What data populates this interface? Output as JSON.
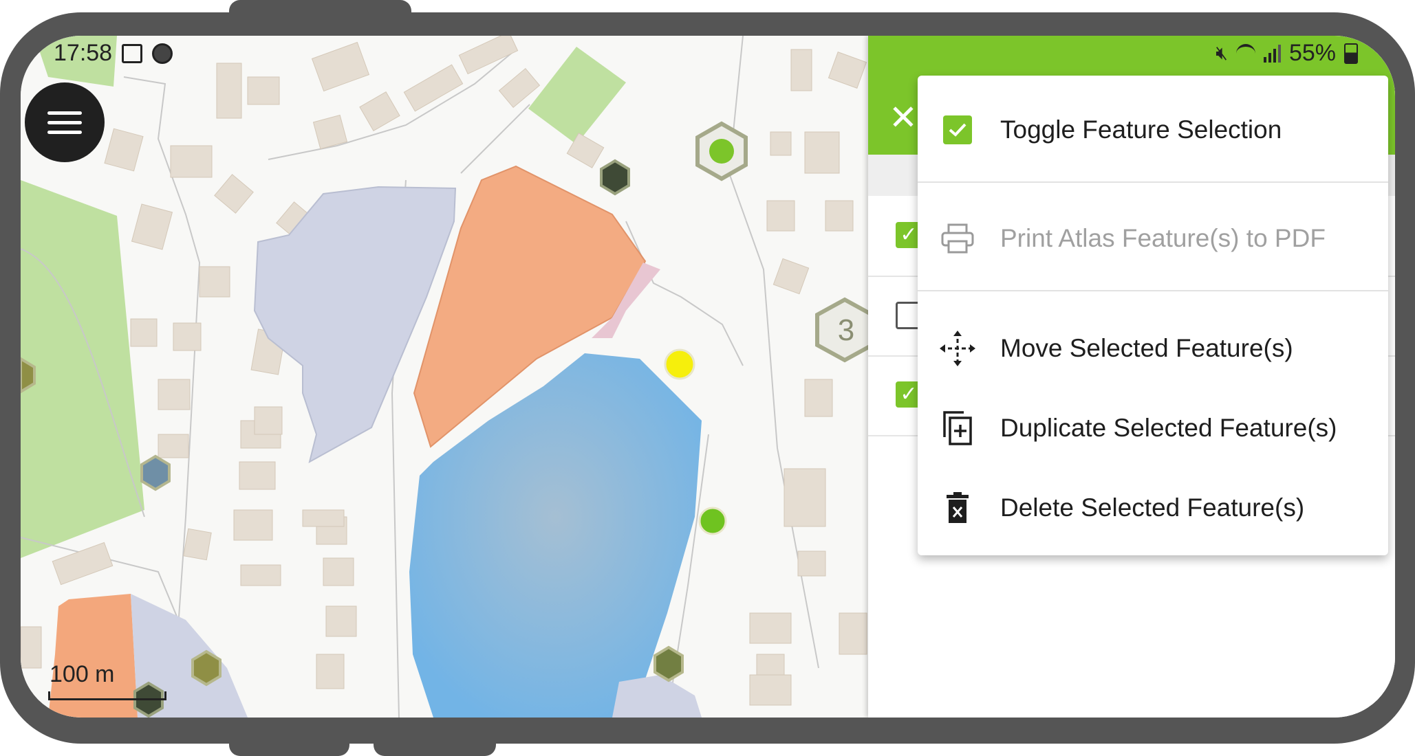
{
  "status_bar": {
    "time": "17:58",
    "battery": "55%"
  },
  "map": {
    "scale_label": "100 m",
    "cluster_count": "3"
  },
  "context_menu": {
    "items": [
      {
        "label": "Toggle Feature Selection",
        "icon": "checkbox-checked-icon",
        "enabled": true
      },
      {
        "label": "Print Atlas Feature(s) to PDF",
        "icon": "printer-icon",
        "enabled": false
      },
      {
        "label": "Move Selected Feature(s)",
        "icon": "move-arrows-icon",
        "enabled": true
      },
      {
        "label": "Duplicate Selected Feature(s)",
        "icon": "duplicate-icon",
        "enabled": true
      },
      {
        "label": "Delete Selected Feature(s)",
        "icon": "trash-icon",
        "enabled": true
      }
    ]
  },
  "colors": {
    "accent_green": "#7cc52a",
    "water": "#7ab8e3",
    "orange_polygon": "#f3a77c",
    "lavender_polygon": "#c9cfe2",
    "park": "#bfe0a0"
  }
}
